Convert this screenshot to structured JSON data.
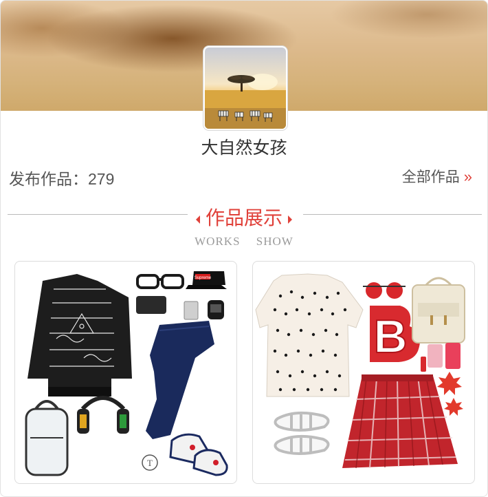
{
  "profile": {
    "name": "大自然女孩",
    "stats_label": "发布作品：279",
    "all_works_label": "全部作品",
    "all_works_icon": "double-chevron-right-icon"
  },
  "section": {
    "title": "作品展示",
    "subtitle": "WORKS SHOW"
  },
  "works": [
    {
      "name": "work-collage-1",
      "logo_text": "Supreme"
    },
    {
      "name": "work-collage-2",
      "logo_text": "B"
    }
  ],
  "colors": {
    "accent": "#e0413a",
    "text": "#333333",
    "muted": "#9a9a9a"
  }
}
